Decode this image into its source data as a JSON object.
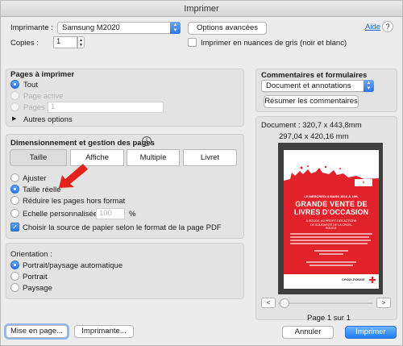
{
  "window": {
    "title": "Imprimer"
  },
  "top": {
    "printer_label": "Imprimante :",
    "printer_value": "Samsung M2020",
    "advanced_button": "Options avancées",
    "help_link": "Aide",
    "copies_label": "Copies :",
    "copies_value": "1",
    "grayscale_label": "Imprimer en nuances de gris (noir et blanc)"
  },
  "pages": {
    "heading": "Pages à imprimer",
    "all": "Tout",
    "active": "Page active",
    "pages_label": "Pages",
    "pages_value": "1",
    "more_options": "Autres options"
  },
  "sizing": {
    "heading": "Dimensionnement et gestion des pages",
    "info_icon": "i",
    "tabs": [
      "Taille",
      "Affiche",
      "Multiple",
      "Livret"
    ],
    "fit": "Ajuster",
    "actual": "Taille réelle",
    "shrink": "Réduire les pages hors format",
    "custom": "Echelle personnalisée :",
    "custom_value": "100",
    "percent": "%",
    "choose_paper": "Choisir la source de papier selon le format de la page PDF"
  },
  "orientation": {
    "heading": "Orientation :",
    "auto": "Portrait/paysage automatique",
    "portrait": "Portrait",
    "landscape": "Paysage"
  },
  "comments": {
    "heading": "Commentaires et formulaires",
    "select_value": "Document et annotations",
    "summarize_button": "Résumer les commentaires"
  },
  "preview": {
    "document_size": "Document : 320,7 x 443,8mm",
    "paper_size": "297,04 x 420,16 mm",
    "page_indicator": "Page 1 sur 1",
    "prev": "<",
    "next": ">",
    "poster_date": "LE MERCREDI 8 MARS 2016 À 19H,",
    "poster_title_1": "GRANDE VENTE DE",
    "poster_title_2": "LIVRES D'OCCASION",
    "poster_sub": "À ROUGE, AU PROFIT DES ACTIONS DE SOLIDARITÉ DE LA CROIX-ROUGE.",
    "poster_badge": "À BRUXELLES",
    "poster_logo": "CROIX-ROUGE"
  },
  "footer": {
    "page_setup": "Mise en page...",
    "printer": "Imprimante...",
    "cancel": "Annuler",
    "print": "Imprimer"
  },
  "colors": {
    "accent": "#2676e8",
    "arrow": "#e3231b",
    "poster_red": "#e1222a"
  }
}
